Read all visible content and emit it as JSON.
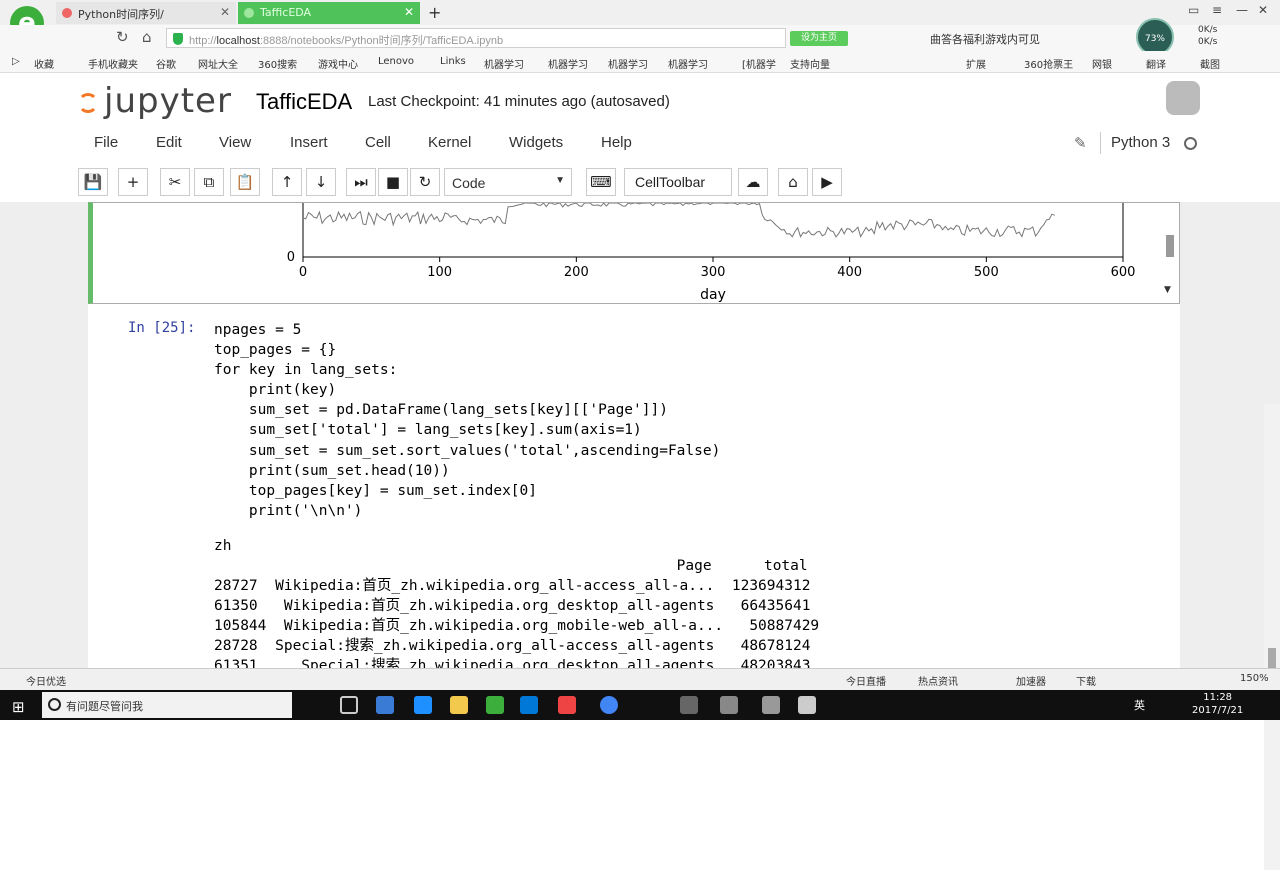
{
  "browser": {
    "tabs": [
      {
        "label": "Python时间序列/"
      },
      {
        "label": "TafficEDA"
      }
    ],
    "url_prefix": "http://",
    "url_host": "localhost",
    "url_rest": ":8888/notebooks/Python时间序列/TafficEDA.ipynb",
    "green_button": "设为主页",
    "search_hint": "曲答各福利游戏内可见",
    "bookmarks": [
      "收藏",
      "手机收藏夹",
      "谷歌",
      "网址大全",
      "360搜索",
      "游戏中心",
      "Lenovo",
      "Links",
      "机器学习",
      "机器学习",
      "机器学习",
      "机器学习",
      "[机器学",
      "支持向量",
      "扩展",
      "360抢票王",
      "网银",
      "翻译",
      "截图"
    ]
  },
  "jupyter": {
    "logo": "jupyter",
    "notebook_title": "TafficEDA",
    "checkpoint": "Last Checkpoint: 41 minutes ago (autosaved)",
    "menu": [
      "File",
      "Edit",
      "View",
      "Insert",
      "Cell",
      "Kernel",
      "Widgets",
      "Help"
    ],
    "kernel": "Python 3",
    "cell_type": "Code",
    "celltoolbar": "CellToolbar"
  },
  "chart_data": {
    "type": "line",
    "xlabel": "day",
    "ylabel": "",
    "xlim": [
      0,
      600
    ],
    "xticks": [
      "0",
      "100",
      "200",
      "300",
      "400",
      "500",
      "600"
    ],
    "ytick_visible": "0",
    "note": "partially scrolled-out time series, values in thousands",
    "series_color": "#777777"
  },
  "cell": {
    "prompt": "In [25]:",
    "code_lines": [
      "npages = 5",
      "top_pages = {}",
      "for key in lang_sets:",
      "    print(key)",
      "    sum_set = pd.DataFrame(lang_sets[key][['Page']])",
      "    sum_set['total'] = lang_sets[key].sum(axis=1)",
      "    sum_set = sum_set.sort_values('total',ascending=False)",
      "    print(sum_set.head(10))",
      "    top_pages[key] = sum_set.index[0]",
      "    print('\\n\\n')"
    ],
    "output_lines": [
      "zh",
      "                                                     Page      total",
      "28727  Wikipedia:首页_zh.wikipedia.org_all-access_all-a...  123694312",
      "61350   Wikipedia:首页_zh.wikipedia.org_desktop_all-agents   66435641",
      "105844  Wikipedia:首页_zh.wikipedia.org_mobile-web_all-a...   50887429",
      "28728  Special:搜索_zh.wikipedia.org_all-access_all-agents   48678124",
      "61351     Special:搜索_zh.wikipedia.org_desktop_all-agents   48203843"
    ]
  },
  "status": {
    "left": "今日优选",
    "items": [
      "今日直播",
      "热点资讯",
      "加速器",
      "下载",
      "150%"
    ]
  },
  "taskbar": {
    "search": "有问题尽管问我",
    "time": "11:28",
    "date": "2017/7/21",
    "lang": "英"
  }
}
